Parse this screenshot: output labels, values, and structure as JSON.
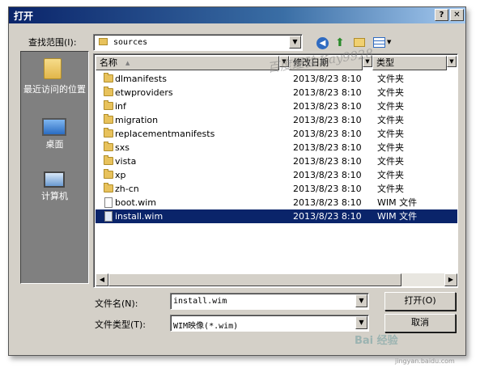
{
  "window": {
    "title": "打开"
  },
  "look_in": {
    "label": "查找范围(I):",
    "value": "sources"
  },
  "places": [
    {
      "label": "最近访问的位置",
      "icon": "recent-places-icon"
    },
    {
      "label": "桌面",
      "icon": "desktop-icon"
    },
    {
      "label": "计算机",
      "icon": "computer-icon"
    }
  ],
  "columns": {
    "name": "名称",
    "date": "修改日期",
    "type": "类型"
  },
  "files": [
    {
      "name": "dlmanifests",
      "date": "2013/8/23 8:10",
      "type": "文件夹",
      "icon": "folder-icon"
    },
    {
      "name": "etwproviders",
      "date": "2013/8/23 8:10",
      "type": "文件夹",
      "icon": "folder-icon"
    },
    {
      "name": "inf",
      "date": "2013/8/23 8:10",
      "type": "文件夹",
      "icon": "folder-icon"
    },
    {
      "name": "migration",
      "date": "2013/8/23 8:10",
      "type": "文件夹",
      "icon": "folder-icon"
    },
    {
      "name": "replacementmanifests",
      "date": "2013/8/23 8:10",
      "type": "文件夹",
      "icon": "folder-icon"
    },
    {
      "name": "sxs",
      "date": "2013/8/23 8:10",
      "type": "文件夹",
      "icon": "folder-icon"
    },
    {
      "name": "vista",
      "date": "2013/8/23 8:10",
      "type": "文件夹",
      "icon": "folder-icon"
    },
    {
      "name": "xp",
      "date": "2013/8/23 8:10",
      "type": "文件夹",
      "icon": "folder-icon"
    },
    {
      "name": "zh-cn",
      "date": "2013/8/23 8:10",
      "type": "文件夹",
      "icon": "folder-icon"
    },
    {
      "name": "boot.wim",
      "date": "2013/8/23 8:10",
      "type": "WIM 文件",
      "icon": "file-icon"
    },
    {
      "name": "install.wim",
      "date": "2013/8/23 8:10",
      "type": "WIM 文件",
      "icon": "file-icon",
      "selected": true
    }
  ],
  "filename": {
    "label": "文件名(N):",
    "value": "install.wim"
  },
  "filetype": {
    "label": "文件类型(T):",
    "value": "WIM映像(*.wim)"
  },
  "buttons": {
    "open": "打开(O)",
    "cancel": "取消"
  },
  "watermark": {
    "text": "百度经验 Kay9928",
    "footer": "Bai 经验",
    "footer_url": "jingyan.baidu.com"
  },
  "colors": {
    "selection": "#0a246a",
    "titlebar": "#0a246a",
    "face": "#d4d0c8"
  }
}
